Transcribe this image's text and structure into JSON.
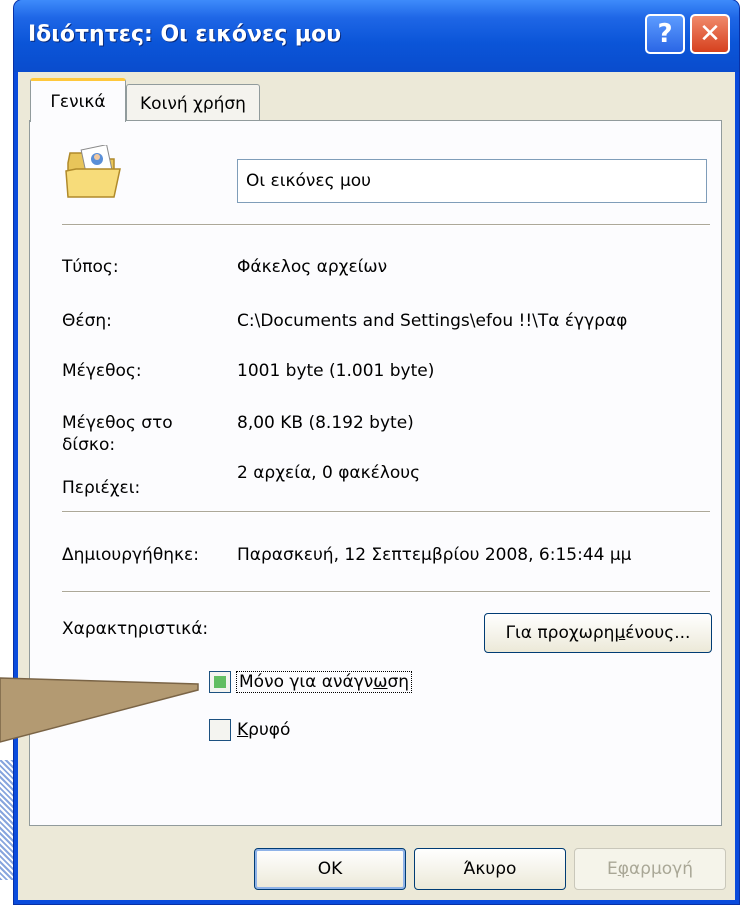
{
  "window": {
    "title": "Ιδιότητες: Οι εικόνες μου"
  },
  "title_buttons": {
    "help_glyph": "?",
    "close_glyph": "✕"
  },
  "tabs": [
    {
      "label": "Γενικά",
      "active": true
    },
    {
      "label": "Κοινή χρήση",
      "active": false
    }
  ],
  "general": {
    "folder_name": "Οι εικόνες μου",
    "icon": "my-pictures-folder-icon",
    "type_label": "Τύπος:",
    "type_value": "Φάκελος αρχείων",
    "location_label": "Θέση:",
    "location_value": "C:\\Documents and Settings\\efou !!\\Τα έγγραφ",
    "size_label": "Μέγεθος:",
    "size_value": "1001 byte (1.001 byte)",
    "size_on_disk_label_line1": "Μέγεθος στο",
    "size_on_disk_label_line2": "δίσκο:",
    "size_on_disk_value": "8,00 KB (8.192 byte)",
    "contains_label": "Περιέχει:",
    "contains_value": "2 αρχεία, 0 φακέλους",
    "created_label": "Δημιουργήθηκε:",
    "created_value": "Παρασκευή, 12 Σεπτεμβρίου 2008, 6:15:44 μμ",
    "attributes_label": "Χαρακτηριστικά:",
    "advanced_pre": "Για προχωρη",
    "advanced_ul": "μ",
    "advanced_post": "ένους...",
    "readonly_pre": "Μόνο για ανάγν",
    "readonly_ul": "ω",
    "readonly_post": "ση",
    "readonly_state": "indeterminate",
    "hidden_ul": "Κ",
    "hidden_post": "ρυφό",
    "hidden_state": "unchecked"
  },
  "buttons": {
    "ok": "OK",
    "cancel": "Άκυρο",
    "apply_pre": "Ε",
    "apply_ul": "φ",
    "apply_post": "αρμογή"
  },
  "colors": {
    "titlebar": "#0a4bdc",
    "dialog_face": "#ece9d8",
    "callout": "#b39a72",
    "checkbox_fill": "#62be62",
    "close_button": "#d6411e"
  }
}
